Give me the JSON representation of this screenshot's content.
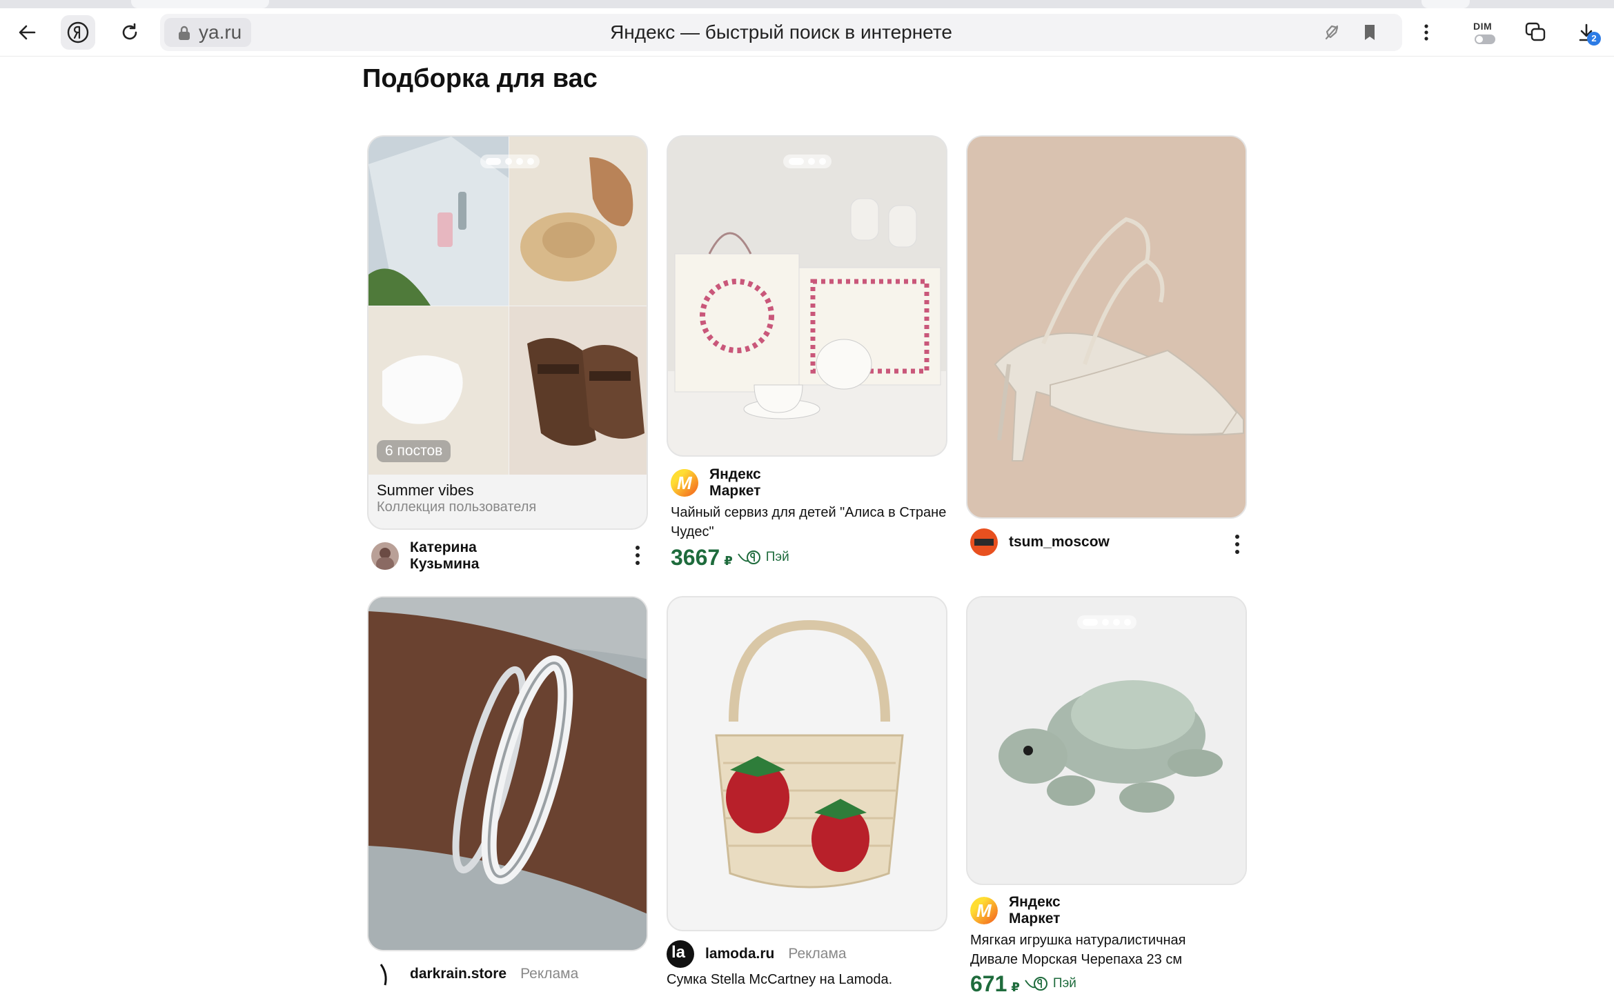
{
  "browser": {
    "url_domain": "ya.ru",
    "page_title": "Яндекс — быстрый поиск в интернете",
    "dim_label": "DIM",
    "downloads_count": "2",
    "icons": [
      "back-icon",
      "yandex-logo-icon",
      "reload-icon",
      "lock-icon",
      "no-tracking-icon",
      "bookmark-icon",
      "menu-dots-icon",
      "dim-toggle-icon",
      "alice-chat-icon",
      "download-icon"
    ]
  },
  "feed": {
    "title": "Подборка для вас",
    "cards": [
      {
        "id": "summer",
        "post_count": "6 постов",
        "collection_title": "Summer vibes",
        "collection_sub": "Коллекция пользователя",
        "author": "Катерина Кузьмина"
      },
      {
        "id": "tea",
        "source": "Яндекс Маркет",
        "description": "Чайный сервиз для детей \"Алиса в Стране Чудес\"",
        "price": "3667",
        "currency": "₽",
        "pay": "Пэй"
      },
      {
        "id": "sandals",
        "source": "tsum_moscow"
      },
      {
        "id": "bracelet",
        "source": "darkrain.store",
        "ad_label": "Реклама"
      },
      {
        "id": "basket",
        "source": "lamoda.ru",
        "ad_label": "Реклама",
        "description": "Сумка Stella McCartney на Lamoda."
      },
      {
        "id": "turtle",
        "source": "Яндекс Маркет",
        "description": "Мягкая игрушка натуралистичная Дивале Морская Черепаха 23 см",
        "price": "671",
        "currency": "₽",
        "pay": "Пэй"
      }
    ]
  }
}
